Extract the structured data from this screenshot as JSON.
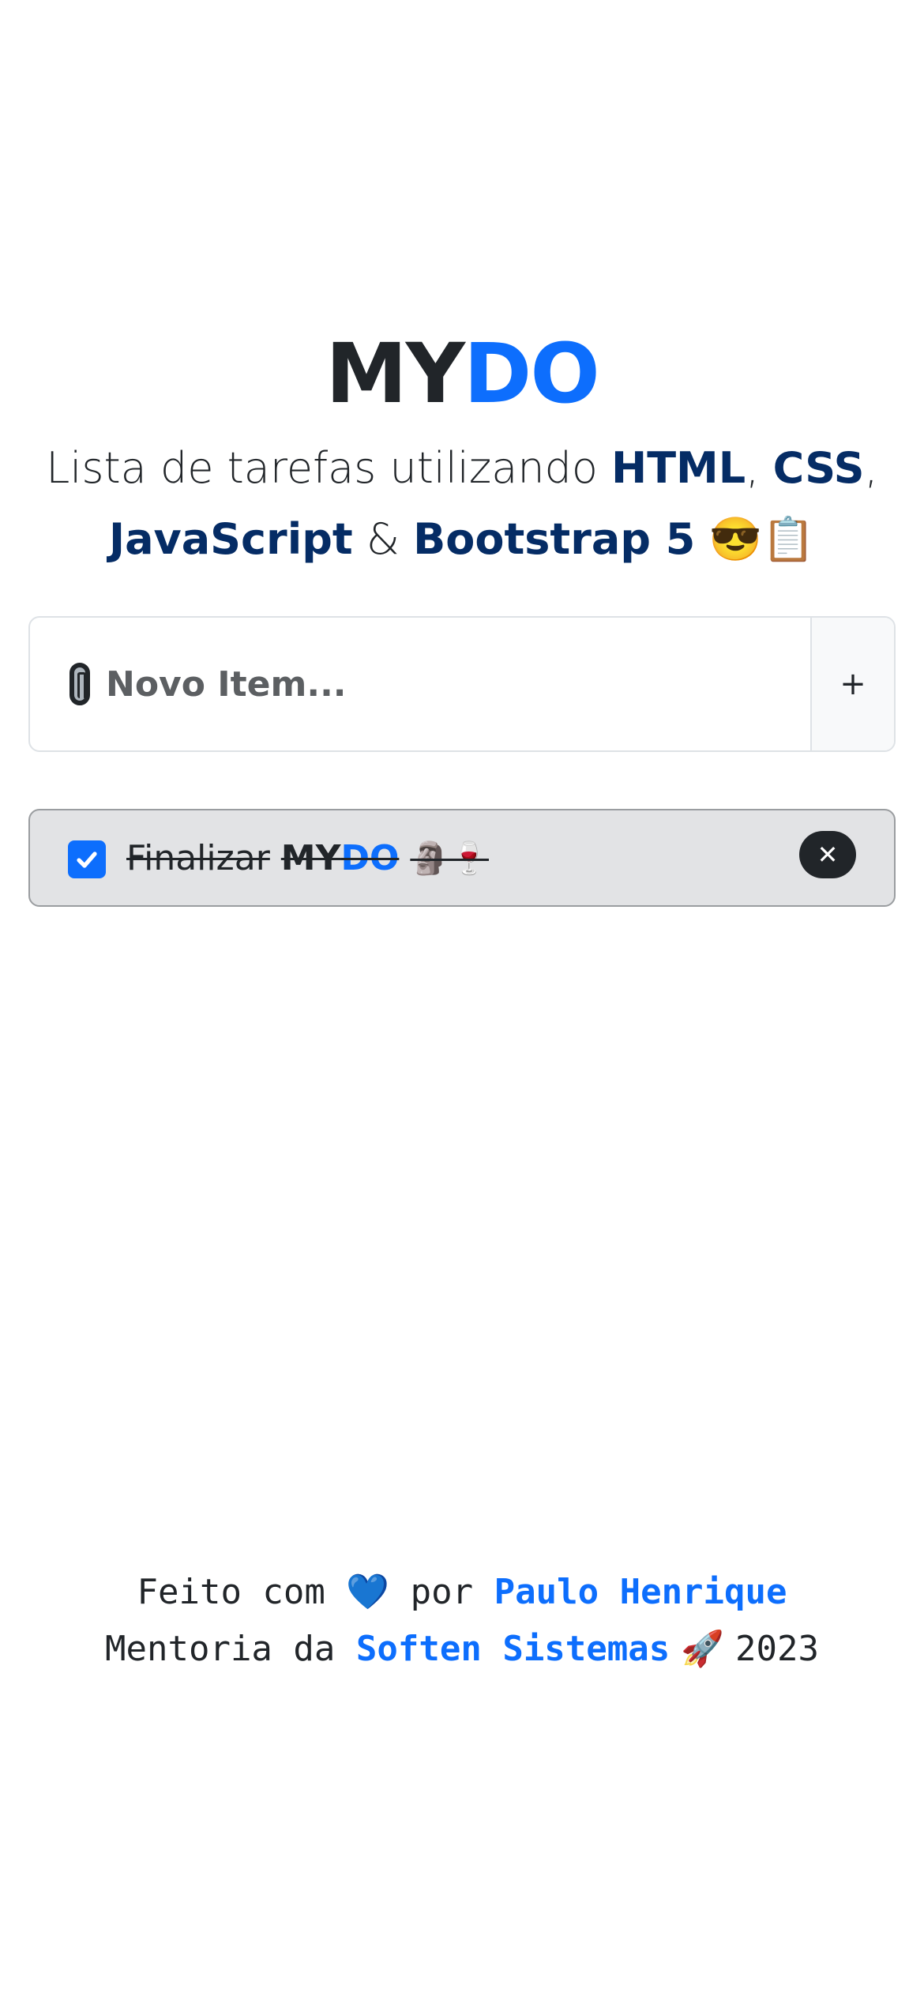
{
  "header": {
    "logo_my": "MY",
    "logo_do": "DO",
    "subtitle_prefix": "Lista de tarefas utilizando ",
    "tech_html": "HTML",
    "sep1": ", ",
    "tech_css": "CSS",
    "sep2": ",",
    "tech_js": "JavaScript",
    "sep3": " & ",
    "tech_bootstrap": "Bootstrap 5",
    "emojis": " 😎📋"
  },
  "new_item": {
    "placeholder": "Novo Item...",
    "icon": "paperclip-icon",
    "add_label": "+"
  },
  "tasks": [
    {
      "checked": true,
      "text_prefix": "Finalizar",
      "bold_my": "MY",
      "bold_do": "DO",
      "emoji": "🗿🍷",
      "delete_label": "✕"
    }
  ],
  "footer": {
    "line1_prefix": "Feito com ",
    "heart": "💙",
    "line1_mid": " por ",
    "author": "Paulo Henrique",
    "line2_prefix": "Mentoria da ",
    "company": "Soften Sistemas",
    "rocket": " 🚀 ",
    "year": "2023"
  },
  "colors": {
    "accent": "#0d6efd",
    "dark_navy": "#052c65",
    "text": "#212529",
    "task_bg": "#e2e3e5"
  }
}
